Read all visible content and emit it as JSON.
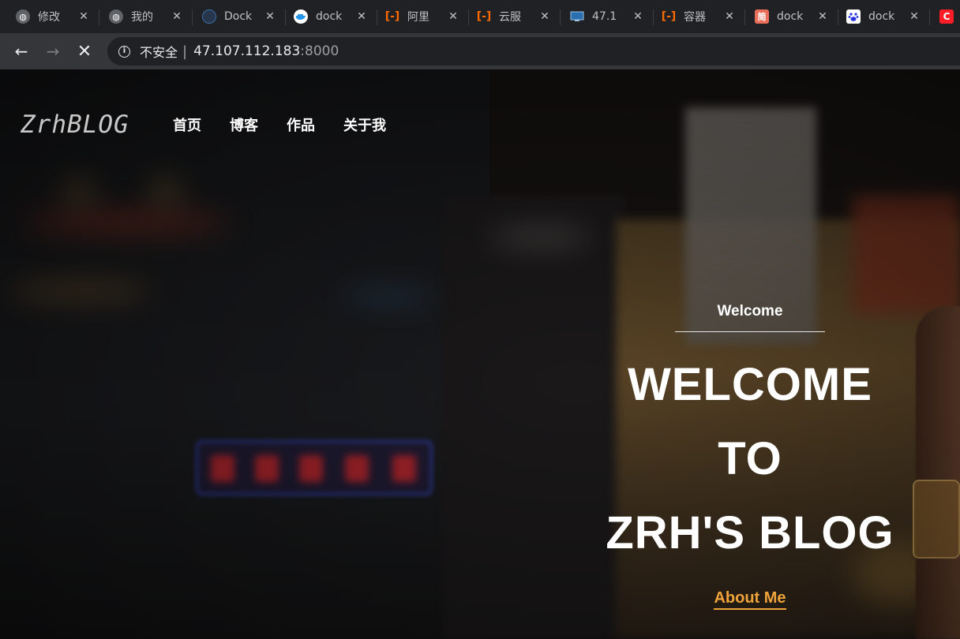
{
  "tabs": [
    {
      "title": "修改",
      "icon": "globe-icon"
    },
    {
      "title": "我的",
      "icon": "globe-icon"
    },
    {
      "title": "Dock",
      "icon": "docker-icon"
    },
    {
      "title": "dock",
      "icon": "docker-whale-icon"
    },
    {
      "title": "阿里",
      "icon": "aliyun-icon"
    },
    {
      "title": "云服",
      "icon": "aliyun-icon"
    },
    {
      "title": "47.1",
      "icon": "monitor-icon"
    },
    {
      "title": "容器",
      "icon": "aliyun-icon"
    },
    {
      "title": "dock",
      "icon": "jianshu-icon",
      "glyph": "简"
    },
    {
      "title": "dock",
      "icon": "baidu-icon"
    },
    {
      "title": "",
      "icon": "csdn-icon",
      "glyph": "C"
    }
  ],
  "toolbar": {
    "back": "←",
    "forward": "→",
    "stop": "✕",
    "not_secure": "不安全",
    "url_host": "47.107.112.183",
    "url_port": ":8000"
  },
  "site": {
    "logo": "ZrhBLOG",
    "nav": [
      "首页",
      "博客",
      "作品",
      "关于我"
    ]
  },
  "hero": {
    "small": "Welcome",
    "line1": "WELCOME",
    "line2": "TO",
    "line3": "ZRH'S BLOG",
    "link": "About Me"
  },
  "colors": {
    "accent": "#f0a33a",
    "chrome_dark": "#202124",
    "chrome_toolbar": "#35363a"
  }
}
